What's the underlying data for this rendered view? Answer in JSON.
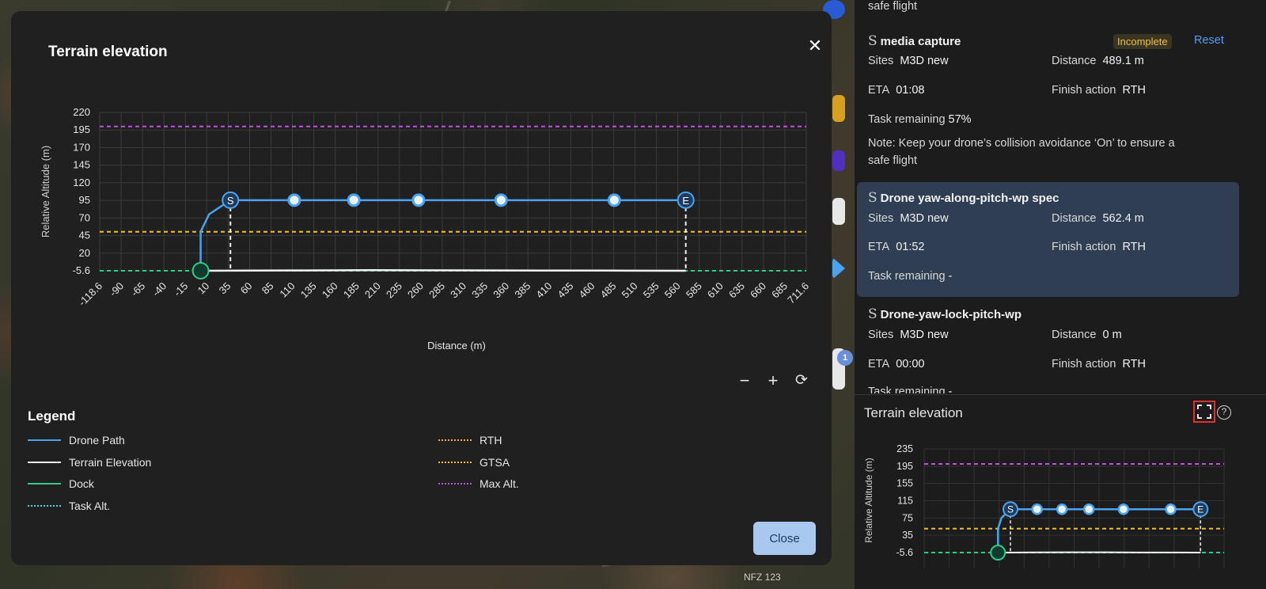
{
  "map": {
    "label": "NFZ 123",
    "badge": "1"
  },
  "modal": {
    "title": "Terrain elevation",
    "close_label": "Close",
    "zoom_out": "−",
    "zoom_in": "+",
    "reset_zoom": "⟳"
  },
  "chart_data": [
    {
      "type": "line",
      "xlabel": "Distance  (m)",
      "ylabel": "Relative Altitude  (m)",
      "x_ticks": [
        "-118.6",
        "-90",
        "-65",
        "-40",
        "-15",
        "10",
        "35",
        "60",
        "85",
        "110",
        "135",
        "160",
        "185",
        "210",
        "235",
        "260",
        "285",
        "310",
        "335",
        "360",
        "385",
        "410",
        "435",
        "460",
        "485",
        "510",
        "535",
        "560",
        "585",
        "610",
        "635",
        "660",
        "685",
        "711.6"
      ],
      "y_ticks": [
        "-5.6",
        "20",
        "45",
        "70",
        "95",
        "120",
        "145",
        "170",
        "195",
        "220"
      ],
      "xlim": [
        -118.6,
        711.6
      ],
      "ylim": [
        -5.6,
        220
      ],
      "grid": true,
      "series": [
        {
          "name": "Drone Path",
          "x": [
            0,
            0,
            10,
            35,
            110,
            180,
            256,
            353,
            486,
            570
          ],
          "y": [
            -5.6,
            50,
            75,
            95,
            95,
            95,
            95,
            95,
            95,
            95
          ]
        },
        {
          "name": "Terrain Elevation",
          "x": [
            0,
            100,
            200,
            300,
            400,
            500,
            570
          ],
          "y": [
            -5.6,
            -5.2,
            -4.8,
            -5.0,
            -5.3,
            -5.4,
            -5.6
          ]
        },
        {
          "name": "Max Alt.",
          "y_const": 200
        },
        {
          "name": "GTSA",
          "y_const": 50
        },
        {
          "name": "Dock",
          "y_const": -5.6
        }
      ],
      "start_marker": "S",
      "end_marker": "E"
    },
    {
      "type": "line",
      "ylabel": "Relative Altitude  (m)",
      "y_ticks": [
        "-5.6",
        "35",
        "75",
        "115",
        "155",
        "195",
        "235"
      ],
      "ylim": [
        -5.6,
        235
      ],
      "grid": true,
      "start_marker": "S",
      "end_marker": "E"
    }
  ],
  "legend": {
    "title": "Legend",
    "items": [
      {
        "label": "Drone Path",
        "color": "#4aa3f0",
        "style": "solid"
      },
      {
        "label": "Terrain Elevation",
        "color": "#f2f2f2",
        "style": "solid"
      },
      {
        "label": "Dock",
        "color": "#2ecc8a",
        "style": "solid"
      },
      {
        "label": "Task Alt.",
        "color": "#40d8e8",
        "style": "dotted"
      },
      {
        "label": "RTH",
        "color": "#f0a860",
        "style": "dotted"
      },
      {
        "label": "GTSA",
        "color": "#f0c030",
        "style": "dotted"
      },
      {
        "label": "Max Alt.",
        "color": "#c050e0",
        "style": "dotted"
      }
    ]
  },
  "panel": {
    "top_note": "safe flight",
    "tasks": [
      {
        "name": "media capture",
        "status": "Incomplete",
        "action": "Reset",
        "sites_label": "Sites",
        "sites": "M3D new",
        "distance_label": "Distance",
        "distance": "489.1 m",
        "eta_label": "ETA",
        "eta": "01:08",
        "finish_label": "Finish action",
        "finish": "RTH",
        "remaining_label": "Task remaining",
        "remaining": "57%",
        "note_line1": "Note: Keep your drone’s collision avoidance ‘On’ to ensure a",
        "note_line2": "safe flight"
      },
      {
        "name": "Drone yaw-along-pitch-wp spec",
        "sites_label": "Sites",
        "sites": "M3D new",
        "distance_label": "Distance",
        "distance": "562.4 m",
        "eta_label": "ETA",
        "eta": "01:52",
        "finish_label": "Finish action",
        "finish": "RTH",
        "remaining_label": "Task remaining",
        "remaining": "-"
      },
      {
        "name": "Drone-yaw-lock-pitch-wp",
        "sites_label": "Sites",
        "sites": "M3D new",
        "distance_label": "Distance",
        "distance": "0 m",
        "eta_label": "ETA",
        "eta": "00:00",
        "finish_label": "Finish action",
        "finish": "RTH",
        "remaining_label": "Task remaining",
        "remaining": "-"
      }
    ],
    "terrain_title": "Terrain elevation",
    "help": "?"
  },
  "colors": {
    "drone_path": "#4aa3f0",
    "terrain": "#f2f2f2",
    "dock": "#2ecc8a",
    "gtsa": "#f0c030",
    "max_alt": "#c050e0",
    "accent": "#a8c8f0",
    "selected_card": "#2f3e52",
    "highlight_box": "#e03030"
  }
}
